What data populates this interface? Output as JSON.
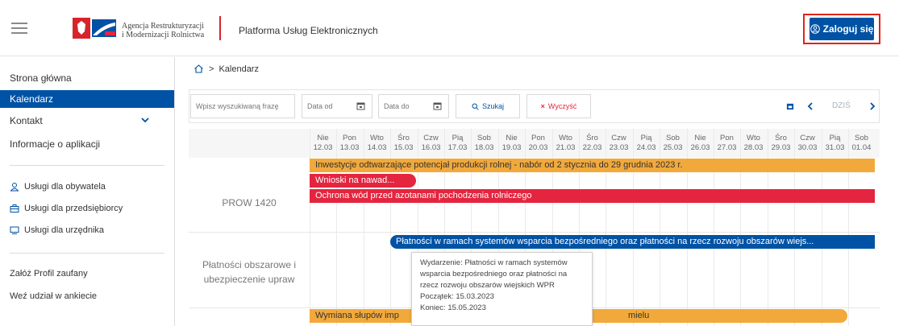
{
  "header": {
    "agency_line1": "Agencja Restrukturyzacji",
    "agency_line2": "i Modernizacji Rolnictwa",
    "platform": "Platforma Usług Elektronicznych",
    "login": "Zaloguj się"
  },
  "sidebar": {
    "items": [
      {
        "label": "Strona główna"
      },
      {
        "label": "Kalendarz"
      },
      {
        "label": "Kontakt"
      },
      {
        "label": "Informacje o aplikacji"
      }
    ],
    "services": [
      {
        "label": "Usługi dla obywatela",
        "icon": "user-icon"
      },
      {
        "label": "Usługi dla przedsiębiorcy",
        "icon": "briefcase-icon"
      },
      {
        "label": "Usługi dla urzędnika",
        "icon": "monitor-icon"
      }
    ],
    "extra": [
      {
        "label": "Załóż Profil zaufany"
      },
      {
        "label": "Weź udział w ankiecie"
      }
    ]
  },
  "breadcrumb": {
    "current": "Kalendarz"
  },
  "filters": {
    "search_placeholder": "Wpisz wyszukiwaną frazę",
    "date_from_placeholder": "Data od",
    "date_to_placeholder": "Data do",
    "search_button": "Szukaj",
    "clear_button": "Wyczyść",
    "today": "DZIŚ"
  },
  "calendar": {
    "days": [
      {
        "name": "Nie",
        "date": "12.03"
      },
      {
        "name": "Pon",
        "date": "13.03"
      },
      {
        "name": "Wto",
        "date": "14.03"
      },
      {
        "name": "Śro",
        "date": "15.03"
      },
      {
        "name": "Czw",
        "date": "16.03"
      },
      {
        "name": "Pią",
        "date": "17.03"
      },
      {
        "name": "Sob",
        "date": "18.03"
      },
      {
        "name": "Nie",
        "date": "19.03"
      },
      {
        "name": "Pon",
        "date": "20.03"
      },
      {
        "name": "Wto",
        "date": "21.03"
      },
      {
        "name": "Śro",
        "date": "22.03"
      },
      {
        "name": "Czw",
        "date": "23.03"
      },
      {
        "name": "Pią",
        "date": "24.03"
      },
      {
        "name": "Sob",
        "date": "25.03"
      },
      {
        "name": "Nie",
        "date": "26.03"
      },
      {
        "name": "Pon",
        "date": "27.03"
      },
      {
        "name": "Wto",
        "date": "28.03"
      },
      {
        "name": "Śro",
        "date": "29.03"
      },
      {
        "name": "Czw",
        "date": "30.03"
      },
      {
        "name": "Pią",
        "date": "31.03"
      },
      {
        "name": "Sob",
        "date": "01.04"
      }
    ],
    "groups": [
      {
        "title": "PROW 1420"
      },
      {
        "title_line1": "Płatności obszarowe i",
        "title_line2": "ubezpieczenie upraw"
      }
    ],
    "events": [
      {
        "label": "Inwestycje odtwarzające potencjał produkcji rolnej - nabór od 2 stycznia do 29 grudnia 2023 r.",
        "color": "#f2a93b"
      },
      {
        "label": "Wnioski na nawad...",
        "color": "#e4253f"
      },
      {
        "label": "Ochrona wód przed azotanami pochodzenia rolniczego",
        "color": "#e4253f"
      },
      {
        "label": "Płatności w ramach systemów wsparcia bezpośredniego oraz płatności na rzecz rozwoju obszarów wiejs...",
        "color": "#0052a5"
      },
      {
        "label_left": "Wymiana słupów imp",
        "label_right": "mielu",
        "color": "#f2a93b"
      }
    ],
    "tooltip": {
      "line1": "Wydarzenie: Płatności w ramach systemów",
      "line2": "wsparcia bezpośredniego oraz płatności na",
      "line3": "rzecz rozwoju obszarów wiejskich WPR",
      "line4": "Początek: 15.03.2023",
      "line5": "Koniec: 15.05.2023"
    }
  }
}
